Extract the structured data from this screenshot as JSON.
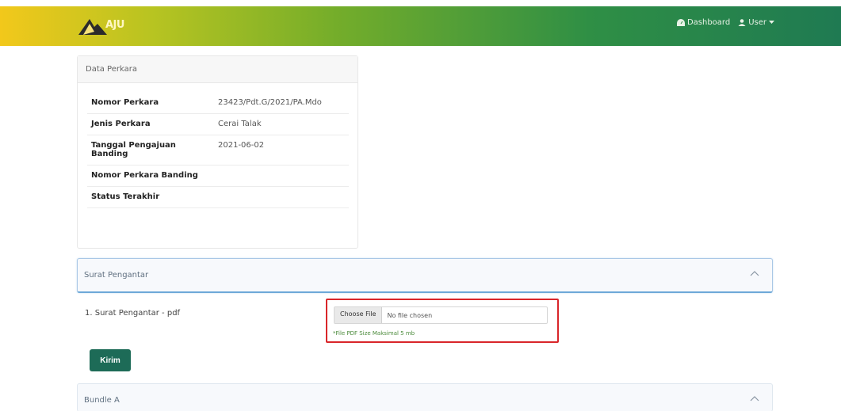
{
  "navbar": {
    "logo_text": "AJU",
    "dashboard_label": "Dashboard",
    "user_label": "User",
    "colors": {
      "start": "#f2c81b",
      "mid": "#74ad2a",
      "end": "#1f7a52"
    }
  },
  "data_perkara": {
    "title": "Data Perkara",
    "rows": [
      {
        "label": "Nomor Perkara",
        "value": "23423/Pdt.G/2021/PA.Mdo"
      },
      {
        "label": "Jenis Perkara",
        "value": "Cerai Talak"
      },
      {
        "label": "Tanggal Pengajuan Banding",
        "value": "2021-06-02"
      },
      {
        "label": "Nomor Perkara Banding",
        "value": ""
      },
      {
        "label": "Status Terakhir",
        "value": ""
      }
    ]
  },
  "surat_pengantar": {
    "title": "Surat Pengantar",
    "item_label": "1.  Surat Pengantar - pdf",
    "choose_file_label": "Choose File",
    "no_file_label": "No file chosen",
    "hint": "*File PDF Size Maksimal 5 mb",
    "submit_label": "Kirim"
  },
  "bundle_a": {
    "title": "Bundle A"
  }
}
